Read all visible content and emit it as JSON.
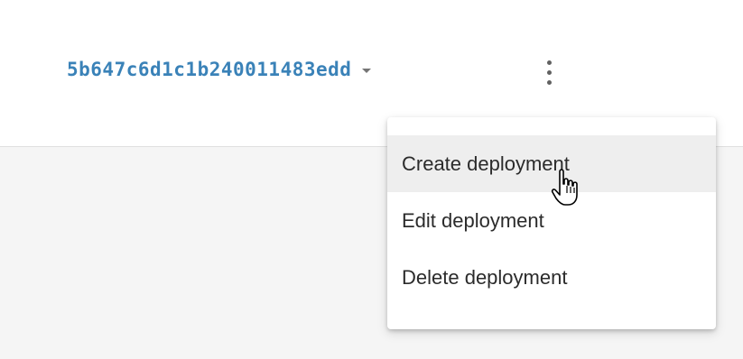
{
  "header": {
    "deployment_id": "5b647c6d1c1b240011483edd"
  },
  "menu": {
    "items": [
      {
        "label": "Create deployment"
      },
      {
        "label": "Edit deployment"
      },
      {
        "label": "Delete deployment"
      }
    ],
    "hovered_index": 0
  },
  "icons": {
    "caret": "chevron-down-icon",
    "more": "more-vert-icon",
    "cursor": "hand-pointer-icon"
  },
  "colors": {
    "accent": "#3a82b8",
    "hover_bg": "#eeeeee"
  }
}
